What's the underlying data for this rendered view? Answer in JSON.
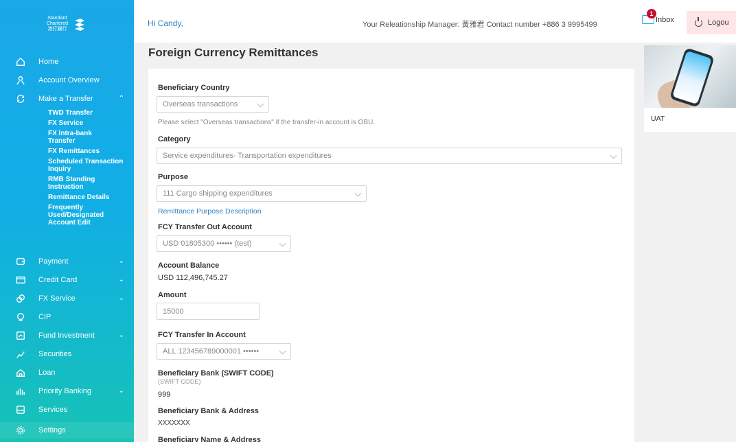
{
  "brand": {
    "logo_line1": "Standard",
    "logo_line2": "Chartered",
    "logo_line3": "渣打銀行"
  },
  "sidebar": {
    "items": [
      {
        "label": "Home",
        "icon": "home-icon"
      },
      {
        "label": "Account Overview",
        "icon": "person-icon"
      },
      {
        "label": "Make a Transfer",
        "icon": "transfer-icon",
        "chevron": "up"
      },
      {
        "label": "Payment",
        "icon": "payment-icon",
        "chevron": "down"
      },
      {
        "label": "Credit Card",
        "icon": "credit-card-icon",
        "chevron": "down"
      },
      {
        "label": "FX Service",
        "icon": "fx-icon",
        "chevron": "down"
      },
      {
        "label": "CIP",
        "icon": "cip-icon"
      },
      {
        "label": "Fund Investment",
        "icon": "fund-icon",
        "chevron": "down"
      },
      {
        "label": "Securities",
        "icon": "securities-icon"
      },
      {
        "label": "Loan",
        "icon": "loan-icon"
      },
      {
        "label": "Priority Banking",
        "icon": "priority-icon",
        "chevron": "down"
      },
      {
        "label": "Services",
        "icon": "services-icon"
      },
      {
        "label": "Settings",
        "icon": "settings-icon"
      }
    ],
    "transfer_sub": [
      "TWD Transfer",
      "FX Service",
      "FX Intra-bank Transfer",
      "FX Remittances",
      "Scheduled Transaction Inquiry",
      "RMB Standing Instruction",
      "Remittance Details",
      "Frequently Used/Designated Account Edit"
    ]
  },
  "header": {
    "greeting": "Hi Candy,",
    "rm_info": "Your Releationship Manager: 黃雅君 Contact number +886 3 9995499",
    "inbox_label": "Inbox",
    "inbox_count": "1",
    "logout_label": "Logou"
  },
  "main": {
    "title": "Foreign Currency Remittances",
    "beneficiary_country_label": "Beneficiary Country",
    "beneficiary_country_value": "Overseas transactions",
    "beneficiary_country_note": "Please select \"Overseas transactions\" if the transfer-in account is OBU.",
    "category_label": "Category",
    "category_value": "Service expenditures- Transportation expenditures",
    "purpose_label": "Purpose",
    "purpose_value": "111 Cargo shipping expenditures",
    "purpose_link": "Remittance Purpose Description",
    "out_account_label": "FCY Transfer Out Account",
    "out_account_value": "USD 01805300 •••••• (test)",
    "balance_label": "Account Balance",
    "balance_value": "USD 112,496,745.27",
    "amount_label": "Amount",
    "amount_value": "15000",
    "in_account_label": "FCY Transfer In Account",
    "in_account_value": "ALL 123456789000001 ••••••",
    "swift_label": "Beneficiary Bank (SWIFT CODE)",
    "swift_sub": "(SWIFT CODE)",
    "swift_value": "999",
    "bank_address_label": "Beneficiary Bank & Address",
    "bank_address_value": "XXXXXXX",
    "name_address_label": "Beneficiary Name & Address"
  },
  "promo": {
    "label": "UAT"
  },
  "colors": {
    "sidebar_top": "#1aa8e6",
    "sidebar_bottom": "#17c3b5",
    "link": "#2f7fc6",
    "badge": "#c8102e",
    "logout_bg": "#fde5e8"
  }
}
